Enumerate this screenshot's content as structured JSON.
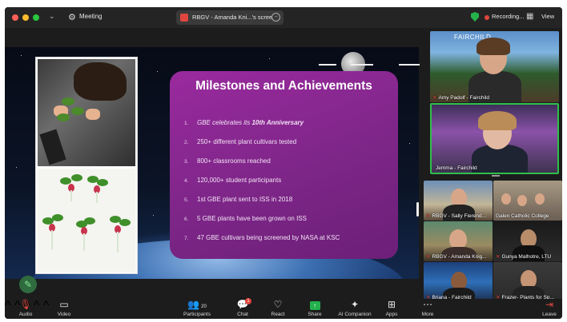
{
  "titlebar": {
    "meeting_label": "Meeting",
    "share_label": "RBGV - Amanda Kni...'s scree",
    "recording_label": "Recording...",
    "view_label": "View"
  },
  "slide": {
    "title": "Milestones and Achievements",
    "items": [
      {
        "num": "1.",
        "pre": "GBE celebrates its ",
        "em": "10th Anniversary"
      },
      {
        "num": "2.",
        "text": "250+ different plant cultivars tested"
      },
      {
        "num": "3.",
        "text": "800+ classrooms reached"
      },
      {
        "num": "4.",
        "text": "120,000+ student participants"
      },
      {
        "num": "5.",
        "text": "1st GBE plant sent to ISS in 2018"
      },
      {
        "num": "6.",
        "text": "5 GBE plants have been grown on ISS"
      },
      {
        "num": "7.",
        "text": "47 GBE cultivars being screened by NASA at KSC"
      }
    ]
  },
  "videos": {
    "large": [
      {
        "name": "Amy Padolf - Fairchild",
        "logo": "FAIRCHILD",
        "muted": true
      },
      {
        "name": "Jemma - Fairchild",
        "muted": false,
        "active_speaker": true
      }
    ],
    "small": [
      {
        "name": "RBGV - Sally Fierend...",
        "muted": true
      },
      {
        "name": "Galen Catholic College",
        "muted": false
      },
      {
        "name": "RBGV - Amanda Knig...",
        "muted": true
      },
      {
        "name": "Gunya Malhotre, LTU",
        "muted": true
      },
      {
        "name": "Briana - Fairchild",
        "muted": true
      },
      {
        "name": "Frazer- Plants for Sp...",
        "muted": true
      }
    ]
  },
  "toolbar": {
    "audio": "Audio",
    "video": "Video",
    "participants": "Participants",
    "participants_count": "20",
    "chat": "Chat",
    "chat_badge": "1",
    "react": "React",
    "share": "Share",
    "ai_companion": "AI Companion",
    "apps": "Apps",
    "more": "More",
    "leave": "Leave"
  },
  "colors": {
    "accent_green": "#2fbf4c",
    "record_red": "#e0463d",
    "panel_purple": "#8a2893"
  },
  "icons": [
    "meeting-icon",
    "shield-icon",
    "grid-icon",
    "mic-muted-icon",
    "camera-icon",
    "participants-icon",
    "chat-icon",
    "react-icon",
    "share-icon",
    "ai-companion-icon",
    "apps-icon",
    "more-icon",
    "leave-icon",
    "annotate-icon"
  ]
}
